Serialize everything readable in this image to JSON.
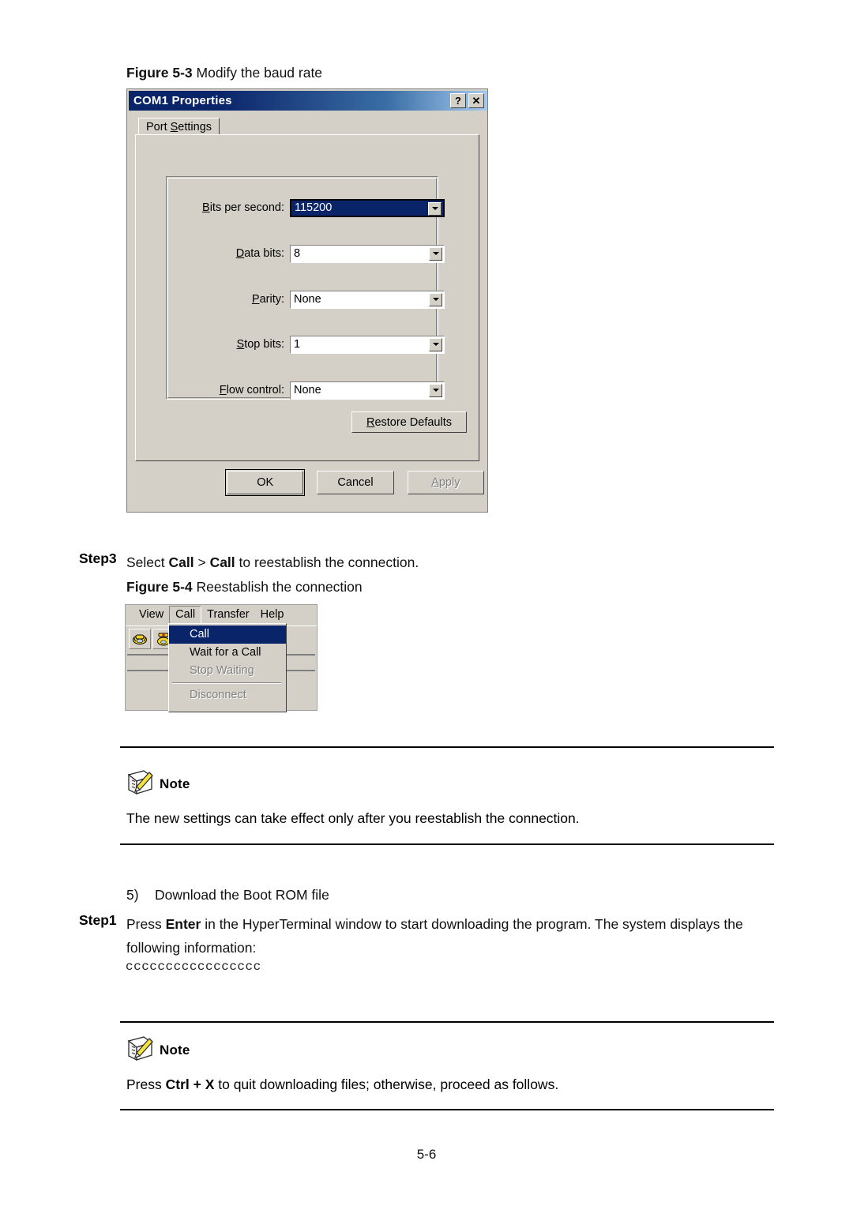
{
  "document": {
    "footer_page": "5-6",
    "figure_5_3": {
      "label": "Figure 5-3",
      "caption": " Modify the baud rate"
    },
    "figure_5_4": {
      "label": "Figure 5-4",
      "caption": " Reestablish the connection"
    },
    "step3": {
      "label": "Step3",
      "text_1": "Select ",
      "bold_1": "Call",
      "text_2": " > ",
      "bold_2": "Call",
      "text_3": " to reestablish the connection."
    },
    "list_item_5": "5)",
    "list_item_5_text": "Download the Boot ROM file",
    "step1": {
      "label": "Step1",
      "text_1": "Press ",
      "bold_1": "Enter",
      "text_2": " in the HyperTerminal window to start downloading the program. The system displays the following information:"
    },
    "console_output": "ccccccccccccccccc",
    "note_1": {
      "title": "Note",
      "icon": "note-pencil-icon",
      "text": "The new settings can take effect only after you reestablish the connection."
    },
    "note_2": {
      "title": "Note",
      "icon": "note-pencil-icon",
      "text_1": "Press ",
      "bold_1": "Ctrl + X",
      "text_2": " to quit downloading files; otherwise, proceed as follows."
    }
  },
  "com1_dialog": {
    "title": "COM1 Properties",
    "help_button": "?",
    "close_button": "✕",
    "tab": {
      "accesskey": "S",
      "before": "Port ",
      "after": "ettings"
    },
    "fields": [
      {
        "name": "bits-per-second",
        "accesskey": "B",
        "label_before": "",
        "label_after": "its per second:",
        "value": "115200",
        "state": "selected"
      },
      {
        "name": "data-bits",
        "accesskey": "D",
        "label_before": "",
        "label_after": "ata bits:",
        "value": "8",
        "state": "normal"
      },
      {
        "name": "parity",
        "accesskey": "P",
        "label_before": "",
        "label_after": "arity:",
        "value": "None",
        "state": "normal"
      },
      {
        "name": "stop-bits",
        "accesskey": "S",
        "label_before": "",
        "label_after": "top bits:",
        "value": "1",
        "state": "normal"
      },
      {
        "name": "flow-control",
        "accesskey": "F",
        "label_before": "",
        "label_after": "low control:",
        "value": "None",
        "state": "normal"
      }
    ],
    "restore_defaults": {
      "accesskey": "R",
      "after": "estore Defaults"
    },
    "buttons": [
      {
        "name": "ok",
        "label": "OK",
        "disabled": false,
        "default": true
      },
      {
        "name": "cancel",
        "label": "Cancel",
        "disabled": false,
        "default": false
      },
      {
        "name": "apply",
        "label": "Apply",
        "disabled": true,
        "default": false
      }
    ]
  },
  "hyperterminal": {
    "menubar": [
      {
        "name": "view",
        "label": "View",
        "open": false
      },
      {
        "name": "call",
        "label": "Call",
        "open": true
      },
      {
        "name": "transfer",
        "label": "Transfer",
        "open": false
      },
      {
        "name": "help",
        "label": "Help",
        "open": false
      }
    ],
    "toolbar": [
      {
        "name": "call-icon"
      },
      {
        "name": "wait-for-call-icon"
      }
    ],
    "call_menu": [
      {
        "name": "call",
        "label": "Call",
        "state": "highlight"
      },
      {
        "name": "wait-for-a-call",
        "label": "Wait for a Call",
        "state": "normal"
      },
      {
        "name": "stop-waiting",
        "label": "Stop Waiting",
        "state": "grayed"
      },
      {
        "name": "separator",
        "label": "",
        "state": "separator"
      },
      {
        "name": "disconnect",
        "label": "Disconnect",
        "state": "grayed"
      }
    ]
  },
  "colors": {
    "titlebar_start": "#0a246a",
    "titlebar_end": "#a6caf0",
    "dialog_face": "#d4d0c8",
    "selection": "#0a246a",
    "disabled_text": "#808080"
  }
}
